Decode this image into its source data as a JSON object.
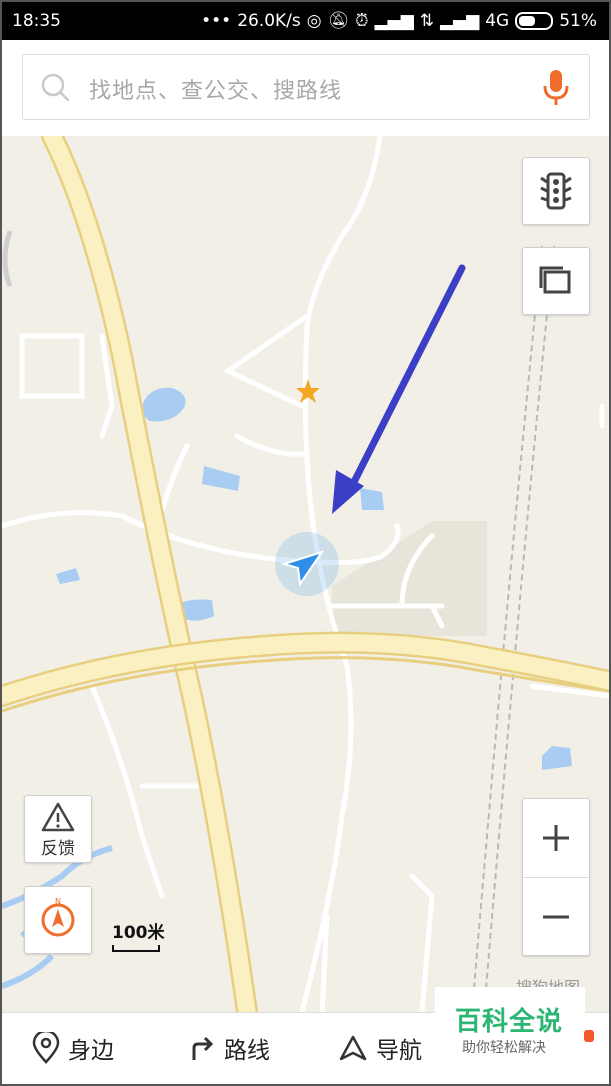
{
  "status_bar": {
    "time": "18:35",
    "speed": "26.0K/s",
    "network": "4G",
    "battery": "51%",
    "battery_level": 0.51
  },
  "search": {
    "placeholder": "找地点、查公交、搜路线"
  },
  "map": {
    "scale_label": "100米",
    "provider_watermark": "搜狗地图"
  },
  "controls": {
    "feedback_label": "反馈",
    "zoom_in": "+",
    "zoom_out": "−"
  },
  "bottom_nav": {
    "items": [
      {
        "label": "身边",
        "icon": "location-pin-icon"
      },
      {
        "label": "路线",
        "icon": "route-turn-icon"
      },
      {
        "label": "导航",
        "icon": "navigation-arrow-icon"
      }
    ]
  },
  "watermark": {
    "title": "百科全说",
    "subtitle": "助你轻松解决"
  },
  "colors": {
    "accent": "#f06d2b",
    "location_blue": "#2f8fe8",
    "annotation_arrow": "#3a3fc6",
    "baike_green": "#2bb673"
  }
}
